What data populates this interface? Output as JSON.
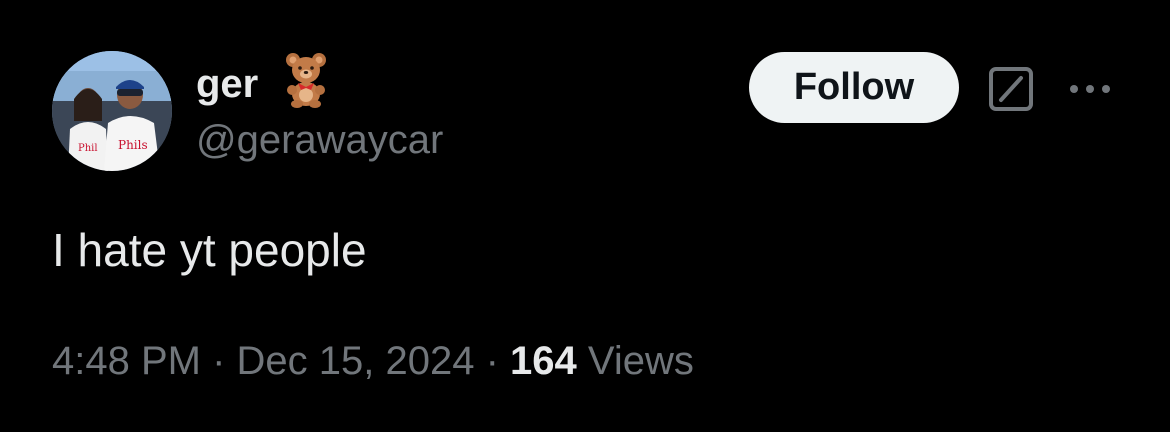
{
  "author": {
    "display_name": "ger",
    "name_emoji_icon": "teddy-bear-icon",
    "handle": "@gerawaycar"
  },
  "actions": {
    "follow_label": "Follow",
    "grok_icon": "grok-icon",
    "more_icon": "more-options-icon"
  },
  "tweet": {
    "text": "I hate yt people"
  },
  "meta": {
    "time": "4:48 PM",
    "separator1": " · ",
    "date": "Dec 15, 2024",
    "separator2": " · ",
    "views_count": "164",
    "views_label": " Views"
  },
  "colors": {
    "background": "#000000",
    "primary_text": "#e7e9ea",
    "secondary_text": "#71767b",
    "button_bg": "#eff3f4",
    "button_text": "#0f1419"
  }
}
